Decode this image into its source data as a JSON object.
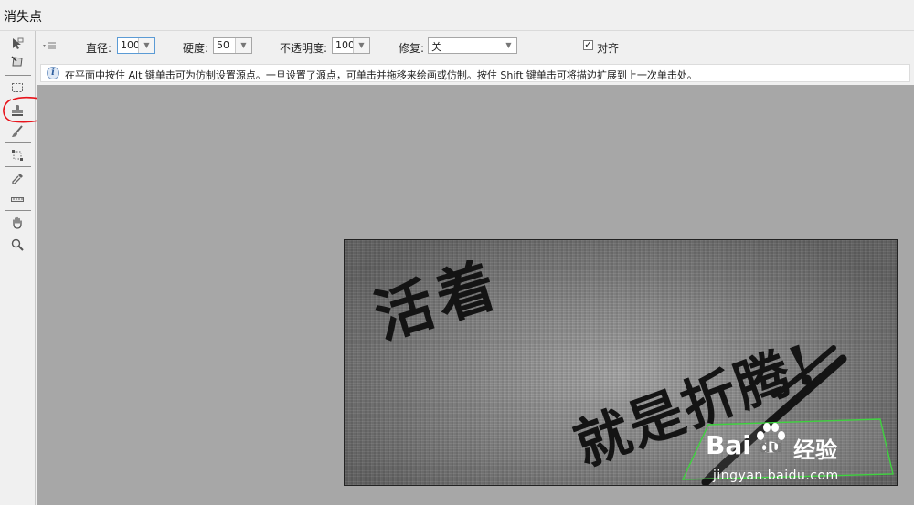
{
  "window": {
    "title": "消失点"
  },
  "tools": [
    {
      "name": "edit-plane-tool"
    },
    {
      "name": "create-plane-tool"
    },
    {
      "name": "marquee-tool"
    },
    {
      "name": "stamp-tool"
    },
    {
      "name": "brush-tool"
    },
    {
      "name": "transform-tool"
    },
    {
      "name": "eyedropper-tool"
    },
    {
      "name": "measure-tool"
    },
    {
      "name": "hand-tool"
    },
    {
      "name": "zoom-tool"
    }
  ],
  "options": {
    "diameter_label": "直径:",
    "diameter_value": "100",
    "hardness_label": "硬度:",
    "hardness_value": "50",
    "opacity_label": "不透明度:",
    "opacity_value": "100",
    "heal_label": "修复:",
    "heal_value": "关",
    "align_label": "对齐",
    "align_checked": true
  },
  "hint": {
    "text": "在平面中按住 Alt 键单击可为仿制设置源点。一旦设置了源点，可单击并拖移来绘画或仿制。按住 Shift 键单击可将描边扩展到上一次单击处。"
  },
  "photo": {
    "text_line1": "活着",
    "text_line2": "就是折腾!",
    "watermark_brand": "Bai",
    "watermark_du": "du",
    "watermark_cn": "经验",
    "watermark_url": "jingyan.baidu.com"
  },
  "colors": {
    "canvas_bg": "#a7a7a7",
    "annotation_red": "#e8141c",
    "watermark_green": "#3fd23f",
    "focus_blue": "#5b9bd5"
  }
}
